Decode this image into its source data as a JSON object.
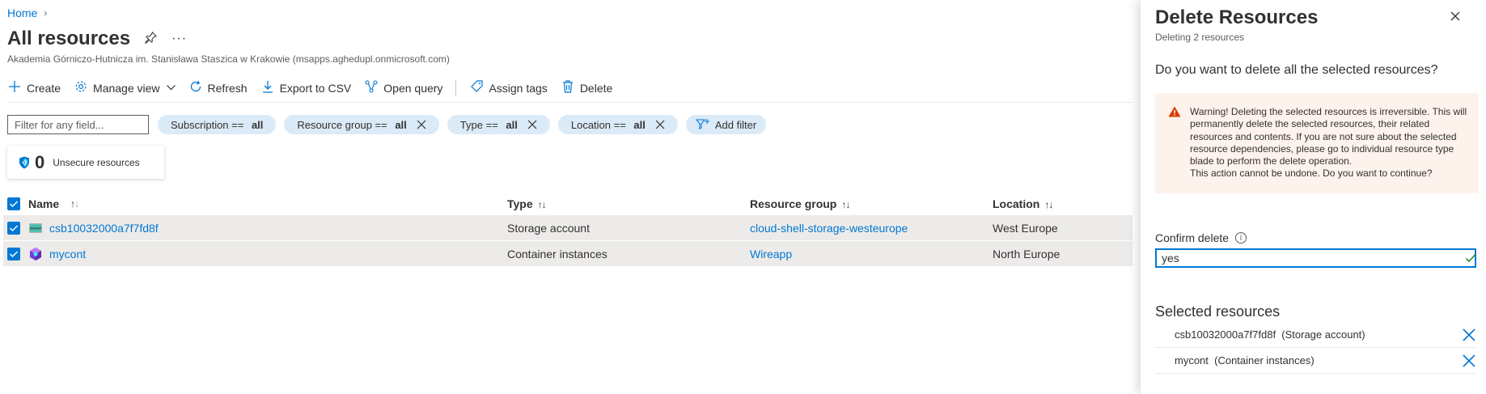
{
  "breadcrumb": {
    "home": "Home",
    "chevron": "›"
  },
  "header": {
    "title": "All resources",
    "subtitle": "Akademia Górniczo-Hutnicza im. Stanisława Staszica w Krakowie (msapps.aghedupl.onmicrosoft.com)",
    "pin_icon": "pin-icon",
    "more_icon": "ellipsis-icon"
  },
  "toolbar": {
    "create": "Create",
    "manage_view": "Manage view",
    "refresh": "Refresh",
    "export_csv": "Export to CSV",
    "open_query": "Open query",
    "assign_tags": "Assign tags",
    "delete": "Delete"
  },
  "filters": {
    "placeholder": "Filter for any field...",
    "subscription": {
      "label": "Subscription == ",
      "value": "all"
    },
    "resource_group": {
      "label": "Resource group == ",
      "value": "all"
    },
    "type": {
      "label": "Type == ",
      "value": "all"
    },
    "location": {
      "label": "Location == ",
      "value": "all"
    },
    "add_filter": "Add filter"
  },
  "security": {
    "count": "0",
    "label": "Unsecure resources"
  },
  "table": {
    "columns": {
      "name": "Name",
      "type": "Type",
      "resource_group": "Resource group",
      "location": "Location"
    },
    "rows": [
      {
        "name": "csb10032000a7f7fd8f",
        "type": "Storage account",
        "resource_group": "cloud-shell-storage-westeurope",
        "location": "West Europe",
        "icon": "storage-account-icon"
      },
      {
        "name": "mycont",
        "type": "Container instances",
        "resource_group": "Wireapp",
        "location": "North Europe",
        "icon": "container-instances-icon"
      }
    ]
  },
  "panel": {
    "title": "Delete Resources",
    "subtitle": "Deleting 2 resources",
    "question": "Do you want to delete all the selected resources?",
    "warning": "Warning! Deleting the selected resources is irreversible. This will permanently delete the selected resources, their related resources and contents. If you are not sure about the selected resource dependencies, please go to individual resource type blade to perform the delete operation.",
    "warning_line2": "This action cannot be undone. Do you want to continue?",
    "confirm_label": "Confirm delete",
    "confirm_value": "yes",
    "selected_title": "Selected resources",
    "selected": [
      "csb10032000a7f7fd8f  (Storage account)",
      "mycont  (Container instances)"
    ]
  },
  "colors": {
    "accent": "#0078d4",
    "selected_row": "#edebe9",
    "warning_bg": "#fdf2ec",
    "warning_icon": "#d83b01"
  }
}
